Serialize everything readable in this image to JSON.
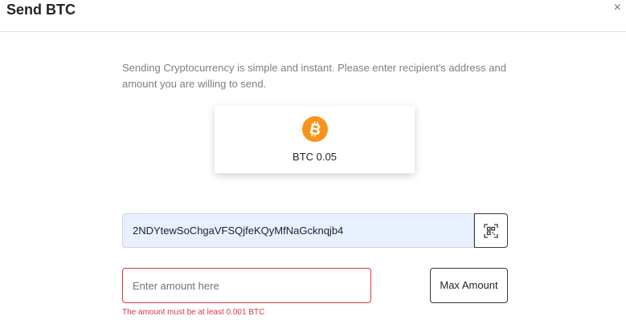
{
  "modal": {
    "title": "Send BTC",
    "close_label": "×"
  },
  "description": "Sending Cryptocurrency is simple and instant. Please enter recipient's address and amount you are willing to send.",
  "coin": {
    "icon": "bitcoin-icon",
    "label": "BTC 0.05",
    "color": "#f7931a"
  },
  "address": {
    "value": "2NDYtewSoChgaVFSQjfeKQyMfNaGcknqjb4",
    "scan_icon": "qr-scan-icon"
  },
  "amount": {
    "placeholder": "Enter amount here",
    "max_label": "Max Amount",
    "error": "The amount must be at least 0.001 BTC",
    "error_color": "#dc3545"
  }
}
